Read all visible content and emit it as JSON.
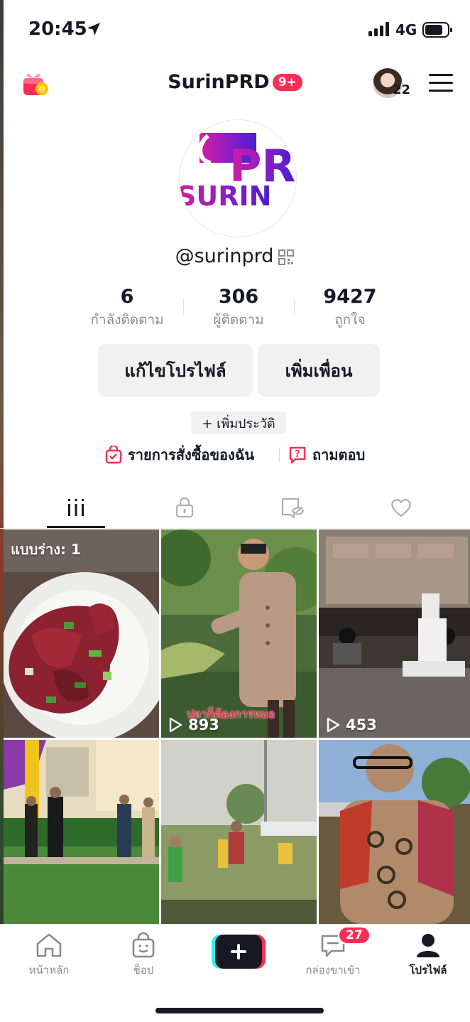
{
  "status_bar": {
    "time": "20:45",
    "network": "4G"
  },
  "header": {
    "title": "SurinPRD",
    "notif_badge": "9+",
    "friends_count": "22"
  },
  "profile": {
    "avatar_text_top": "PR",
    "avatar_text_bottom": "SURIN",
    "username": "@surinprd",
    "stats": [
      {
        "value": "6",
        "label": "กำลังติดตาม"
      },
      {
        "value": "306",
        "label": "ผู้ติดตาม"
      },
      {
        "value": "9427",
        "label": "ถูกใจ"
      }
    ],
    "edit_profile": "แก้ไขโปรไฟล์",
    "add_friends": "เพิ่มเพื่อน",
    "add_bio": "+ เพิ่มประวัติ",
    "orders": "รายการสั่งซื้อของฉัน",
    "qa": "ถามตอบ"
  },
  "tabs": [
    "videos-grid-icon",
    "lock-icon",
    "repost-hidden-icon",
    "heart-icon"
  ],
  "videos": [
    {
      "draft": "แบบร่าง: 1"
    },
    {
      "views": "893",
      "caption": "ปลาก็ต้องการหมอ"
    },
    {
      "views": "453"
    },
    {},
    {},
    {}
  ],
  "bottom_nav": {
    "home": "หน้าหลัก",
    "shop": "ช็อป",
    "inbox": "กล่องขาเข้า",
    "inbox_badge": "27",
    "profile": "โปรไฟล์"
  },
  "colors": {
    "accent": "#fe2c55",
    "text": "#161823",
    "muted": "#8a8b91",
    "brand_purple": "#8a1cc9"
  }
}
